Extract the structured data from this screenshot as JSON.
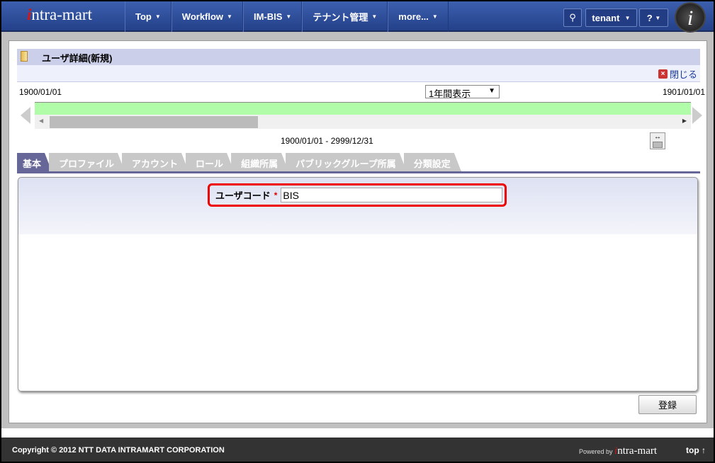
{
  "header": {
    "logo": "intra-mart",
    "nav": [
      {
        "label": "Top"
      },
      {
        "label": "Workflow"
      },
      {
        "label": "IM-BIS"
      },
      {
        "label": "テナント管理"
      },
      {
        "label": "more..."
      }
    ],
    "user": "tenant",
    "help": "?"
  },
  "page": {
    "title": "ユーザ詳細(新規)",
    "close_label": "閉じる"
  },
  "timeline": {
    "start": "1900/01/01",
    "end": "1901/01/01",
    "view_select": "1年間表示",
    "range": "1900/01/01 - 2999/12/31"
  },
  "tabs": [
    {
      "label": "基本"
    },
    {
      "label": "プロファイル"
    },
    {
      "label": "アカウント"
    },
    {
      "label": "ロール"
    },
    {
      "label": "組織所属"
    },
    {
      "label": "パブリックグループ所属"
    },
    {
      "label": "分類設定"
    }
  ],
  "form": {
    "user_code_label": "ユーザコード",
    "required_mark": "*",
    "user_code_value": "BIS"
  },
  "buttons": {
    "register": "登録"
  },
  "footer": {
    "copyright": "Copyright © 2012 NTT DATA INTRAMART CORPORATION",
    "powered_by": "Powered by",
    "powered_logo": "intra-mart",
    "top_link": "top ↑"
  }
}
